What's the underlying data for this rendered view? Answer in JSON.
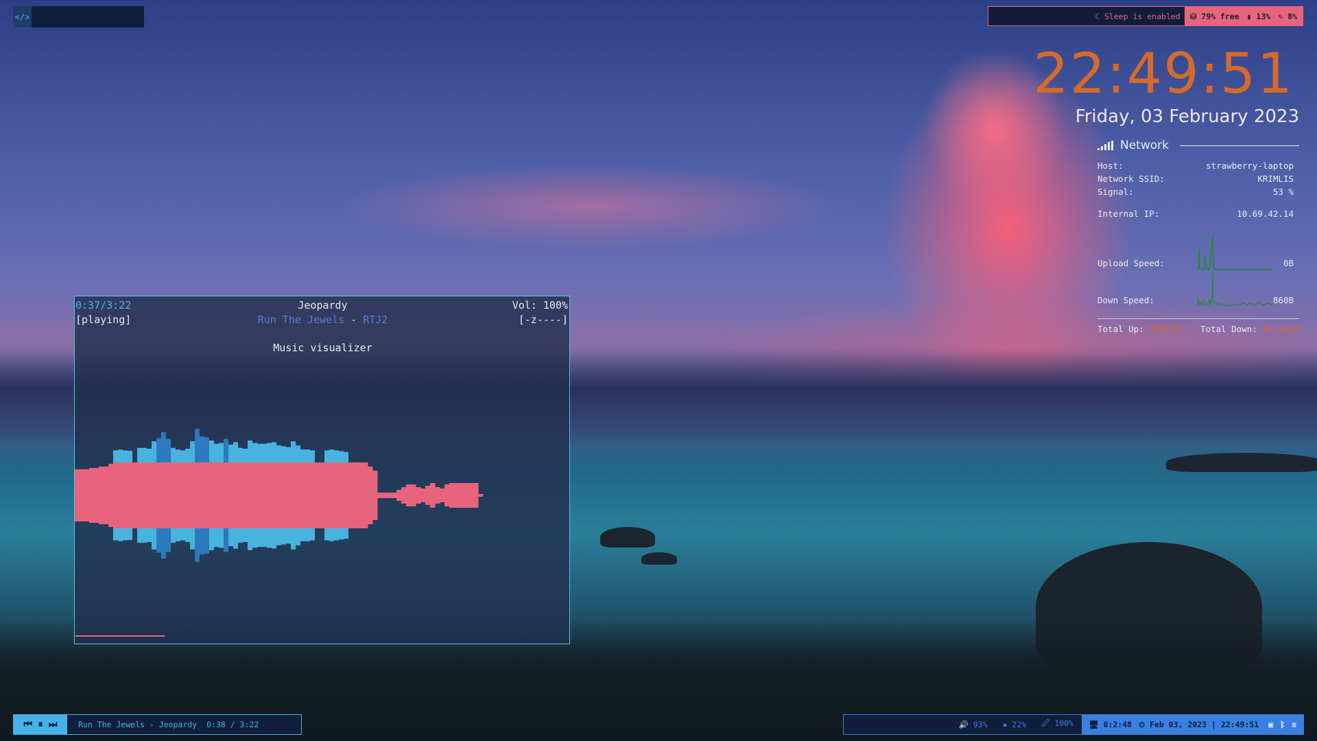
{
  "top_left": {
    "icon": "</>"
  },
  "status_bar": {
    "sleep_text": "☾ Sleep is enabled",
    "disk": "⛁ 79% free",
    "battery": "▮ 13%",
    "brightness": "✎ 8%"
  },
  "clock": {
    "time": "22:49:51",
    "date": "Friday, 03 February 2023"
  },
  "network": {
    "title": "Network",
    "host_label": "Host:",
    "host_value": "strawberry-laptop",
    "ssid_label": "Network SSID:",
    "ssid_value": "KRIMLIS",
    "signal_label": "Signal:",
    "signal_value": "53 %",
    "ip_label": "Internal IP:",
    "ip_value": "10.69.42.14",
    "upload_label": "Upload Speed:",
    "upload_value": "0B",
    "down_label": "Down Speed:",
    "down_value": "860B",
    "total_up_label": "Total Up:",
    "total_up_value": "376KiB",
    "total_down_label": "Total Down:",
    "total_down_value": "46.6MiB",
    "accent": "#d56a2b",
    "graph_color": "#1f8a3a"
  },
  "player": {
    "position": "0:37/3:22",
    "state": "[playing]",
    "title": "Jeopardy",
    "artist": "Run The Jewels",
    "separator": " - ",
    "album": "RTJ2",
    "volume": "Vol: 100%",
    "mode": "[-z----]",
    "visualizer_label": "Music visualizer",
    "progress": 0.18,
    "colors": {
      "accent": "#45b6e8",
      "wave": "#e8647c",
      "bars": "#4ab9e6",
      "bars_dark": "#2d7dc4"
    }
  },
  "mini_player": {
    "controls": "⏮ ⏸ ⏭",
    "track": "Run The Jewels - Jeopardy",
    "time": "0:38 / 3:22"
  },
  "bottom_right": {
    "volume": "🔊 93%",
    "brightness": "✹ 22%",
    "power": "🖉 100%",
    "uptime": "🖥 0:2:48",
    "datetime": "⏲ Feb 03, 2023 | 22:49:51",
    "tray_image": "▣",
    "tray_bluetooth": "ᛒ",
    "tray_wifi": "≋"
  }
}
